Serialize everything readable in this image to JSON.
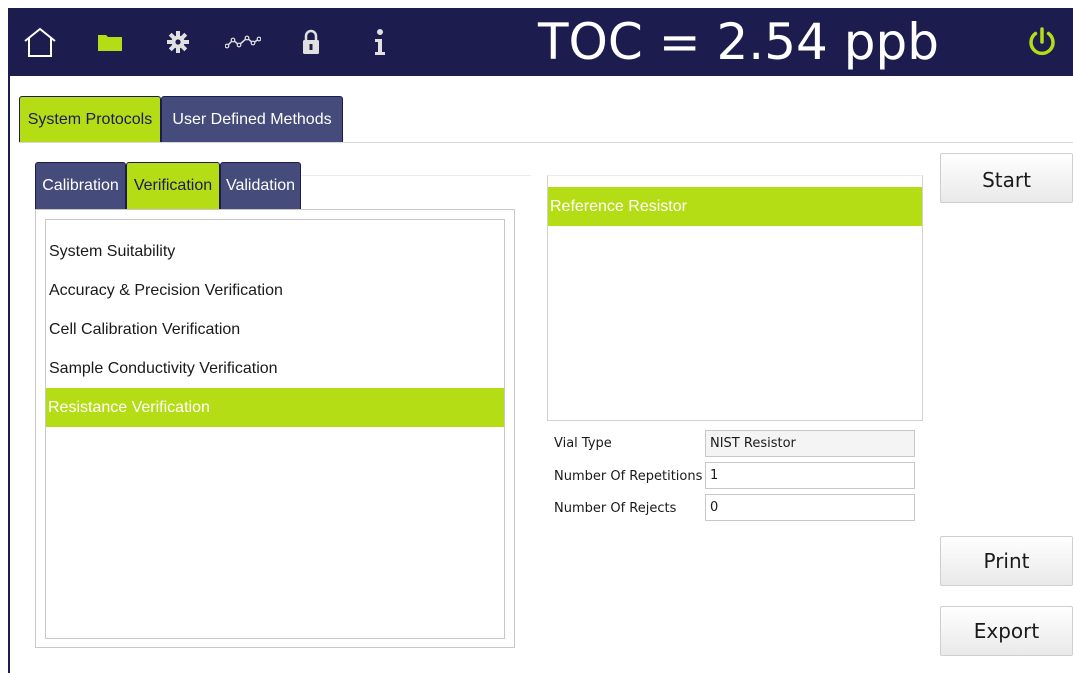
{
  "header": {
    "toc_reading": "TOC = 2.54 ppb",
    "icons": [
      "home-icon",
      "folder-icon",
      "gear-icon",
      "trend-icon",
      "lock-icon",
      "info-icon",
      "power-icon"
    ],
    "colors": {
      "background": "#1c1d4e",
      "accent": "#b5dd15",
      "icon": "#ffffff"
    }
  },
  "top_tabs": [
    {
      "label": "System Protocols",
      "active": true
    },
    {
      "label": "User Defined Methods",
      "active": false
    }
  ],
  "sub_tabs": [
    {
      "label": "Calibration",
      "active": false
    },
    {
      "label": "Verification",
      "active": true
    },
    {
      "label": "Validation",
      "active": false
    }
  ],
  "protocol_list": {
    "items": [
      {
        "label": "System Suitability",
        "selected": false
      },
      {
        "label": "Accuracy & Precision Verification",
        "selected": false
      },
      {
        "label": "Cell Calibration Verification",
        "selected": false
      },
      {
        "label": "Sample Conductivity Verification",
        "selected": false
      },
      {
        "label": "Resistance Verification",
        "selected": true
      }
    ]
  },
  "reference_panel": {
    "header": "Reference Resistor"
  },
  "fields": {
    "vial_type": {
      "label": "Vial Type",
      "value": "NIST Resistor"
    },
    "repetitions": {
      "label": "Number Of Repetitions",
      "value": "1"
    },
    "rejects": {
      "label": "Number Of Rejects",
      "value": "0"
    }
  },
  "buttons": {
    "start": "Start",
    "print": "Print",
    "export": "Export"
  }
}
